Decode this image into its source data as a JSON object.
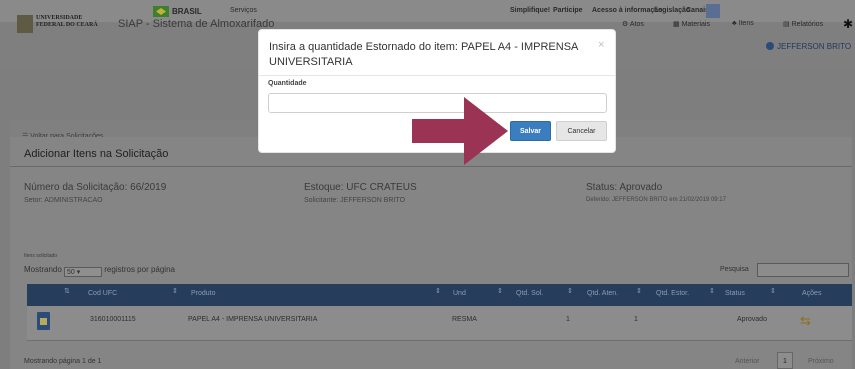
{
  "govbar": {
    "brasil": "BRASIL",
    "servicos": "Serviços",
    "links": [
      "Simplifique!",
      "Participe",
      "Acesso à informação",
      "Legislação",
      "Canais"
    ]
  },
  "header": {
    "logo_line1": "UNIVERSIDADE",
    "logo_line2": "FEDERAL DO CEARÁ",
    "app_title": "SIAP - Sistema de Almoxarifado",
    "menu": [
      "Atos",
      "Materiais",
      "Itens",
      "Relatórios"
    ],
    "user": "JEFFERSON BRITO"
  },
  "back_link": "☰ Voltar para Solicitações",
  "panel_title": "Adicionar Itens na Solicitação",
  "info": {
    "solicitacao": "Número da Solicitação: 66/2019",
    "setor": "Setor: ADMINISTRACAO",
    "estoque": "Estoque: UFC CRATEUS",
    "solicitante": "Solicitante: JEFFERSON BRITO",
    "status": "Status: Aprovado",
    "deferido": "Deferido: JEFFERSON BRITO em 21/02/2019 09:17"
  },
  "itens_label": "Itens solicitado",
  "show": {
    "prefix": "Mostrando",
    "value": "50",
    "suffix": "registros por página"
  },
  "search_label": "Pesquisa",
  "table": {
    "headers": [
      "Cod UFC",
      "Produto",
      "Und",
      "Qtd. Sol.",
      "Qtd. Aten.",
      "Qtd. Estor.",
      "Status",
      "Ações"
    ],
    "rows": [
      {
        "cod": "316010001115",
        "produto": "PAPEL A4 - IMPRENSA UNIVERSITARIA",
        "und": "RESMA",
        "qtd_sol": "1",
        "qtd_aten": "1",
        "qtd_estor": "",
        "status": "Aprovado"
      }
    ]
  },
  "footer": {
    "info": "Mostrando página 1 de 1",
    "prev": "Anterior",
    "page": "1",
    "next": "Próximo"
  },
  "modal": {
    "title": "Insira a quantidade Estornado do item: PAPEL A4 - IMPRENSA UNIVERSITARIA",
    "close": "×",
    "label": "Quantidade",
    "input_value": "",
    "salvar": "Salvar",
    "cancelar": "Cancelar"
  },
  "colors": {
    "table_header": "#273d5c",
    "primary_button": "#3a7ec0",
    "arrow": "#9b3354"
  }
}
